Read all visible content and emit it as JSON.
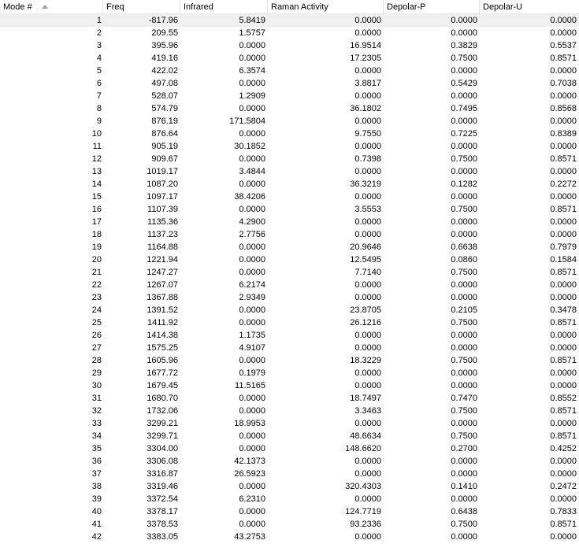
{
  "columns": {
    "mode": "Mode #",
    "freq": "Freq",
    "infrared": "Infrared",
    "raman": "Raman Activity",
    "depolar_p": "Depolar-P",
    "depolar_u": "Depolar-U"
  },
  "sort": {
    "column": "mode",
    "direction": "ascending",
    "icon": "sort-ascending-icon"
  },
  "rows": [
    [
      "1",
      "-817.96",
      "5.8419",
      "0.0000",
      "0.0000",
      "0.0000"
    ],
    [
      "2",
      "209.55",
      "1.5757",
      "0.0000",
      "0.0000",
      "0.0000"
    ],
    [
      "3",
      "395.96",
      "0.0000",
      "16.9514",
      "0.3829",
      "0.5537"
    ],
    [
      "4",
      "419.16",
      "0.0000",
      "17.2305",
      "0.7500",
      "0.8571"
    ],
    [
      "5",
      "422.02",
      "6.3574",
      "0.0000",
      "0.0000",
      "0.0000"
    ],
    [
      "6",
      "497.08",
      "0.0000",
      "3.8817",
      "0.5429",
      "0.7038"
    ],
    [
      "7",
      "528.07",
      "1.2909",
      "0.0000",
      "0.0000",
      "0.0000"
    ],
    [
      "8",
      "574.79",
      "0.0000",
      "36.1802",
      "0.7495",
      "0.8568"
    ],
    [
      "9",
      "876.19",
      "171.5804",
      "0.0000",
      "0.0000",
      "0.0000"
    ],
    [
      "10",
      "876.64",
      "0.0000",
      "9.7550",
      "0.7225",
      "0.8389"
    ],
    [
      "11",
      "905.19",
      "30.1852",
      "0.0000",
      "0.0000",
      "0.0000"
    ],
    [
      "12",
      "909.67",
      "0.0000",
      "0.7398",
      "0.7500",
      "0.8571"
    ],
    [
      "13",
      "1019.17",
      "3.4844",
      "0.0000",
      "0.0000",
      "0.0000"
    ],
    [
      "14",
      "1087.20",
      "0.0000",
      "36.3219",
      "0.1282",
      "0.2272"
    ],
    [
      "15",
      "1097.17",
      "38.4206",
      "0.0000",
      "0.0000",
      "0.0000"
    ],
    [
      "16",
      "1107.39",
      "0.0000",
      "3.5553",
      "0.7500",
      "0.8571"
    ],
    [
      "17",
      "1135.36",
      "4.2900",
      "0.0000",
      "0.0000",
      "0.0000"
    ],
    [
      "18",
      "1137.23",
      "2.7756",
      "0.0000",
      "0.0000",
      "0.0000"
    ],
    [
      "19",
      "1164.88",
      "0.0000",
      "20.9646",
      "0.6638",
      "0.7979"
    ],
    [
      "20",
      "1221.94",
      "0.0000",
      "12.5495",
      "0.0860",
      "0.1584"
    ],
    [
      "21",
      "1247.27",
      "0.0000",
      "7.7140",
      "0.7500",
      "0.8571"
    ],
    [
      "22",
      "1267.07",
      "6.2174",
      "0.0000",
      "0.0000",
      "0.0000"
    ],
    [
      "23",
      "1367.88",
      "2.9349",
      "0.0000",
      "0.0000",
      "0.0000"
    ],
    [
      "24",
      "1391.52",
      "0.0000",
      "23.8705",
      "0.2105",
      "0.3478"
    ],
    [
      "25",
      "1411.92",
      "0.0000",
      "26.1216",
      "0.7500",
      "0.8571"
    ],
    [
      "26",
      "1414.38",
      "1.1735",
      "0.0000",
      "0.0000",
      "0.0000"
    ],
    [
      "27",
      "1575.25",
      "4.9107",
      "0.0000",
      "0.0000",
      "0.0000"
    ],
    [
      "28",
      "1605.96",
      "0.0000",
      "18.3229",
      "0.7500",
      "0.8571"
    ],
    [
      "29",
      "1677.72",
      "0.1979",
      "0.0000",
      "0.0000",
      "0.0000"
    ],
    [
      "30",
      "1679.45",
      "11.5165",
      "0.0000",
      "0.0000",
      "0.0000"
    ],
    [
      "31",
      "1680.70",
      "0.0000",
      "18.7497",
      "0.7470",
      "0.8552"
    ],
    [
      "32",
      "1732.06",
      "0.0000",
      "3.3463",
      "0.7500",
      "0.8571"
    ],
    [
      "33",
      "3299.21",
      "18.9953",
      "0.0000",
      "0.0000",
      "0.0000"
    ],
    [
      "34",
      "3299.71",
      "0.0000",
      "48.6634",
      "0.7500",
      "0.8571"
    ],
    [
      "35",
      "3304.00",
      "0.0000",
      "148.6620",
      "0.2700",
      "0.4252"
    ],
    [
      "36",
      "3306.08",
      "42.1373",
      "0.0000",
      "0.0000",
      "0.0000"
    ],
    [
      "37",
      "3316.87",
      "26.5923",
      "0.0000",
      "0.0000",
      "0.0000"
    ],
    [
      "38",
      "3319.46",
      "0.0000",
      "320.4303",
      "0.1410",
      "0.2472"
    ],
    [
      "39",
      "3372.54",
      "6.2310",
      "0.0000",
      "0.0000",
      "0.0000"
    ],
    [
      "40",
      "3378.17",
      "0.0000",
      "124.7719",
      "0.6438",
      "0.7833"
    ],
    [
      "41",
      "3378.53",
      "0.0000",
      "93.2336",
      "0.7500",
      "0.8571"
    ],
    [
      "42",
      "3383.05",
      "43.2753",
      "0.0000",
      "0.0000",
      "0.0000"
    ]
  ],
  "selected_row": 0
}
